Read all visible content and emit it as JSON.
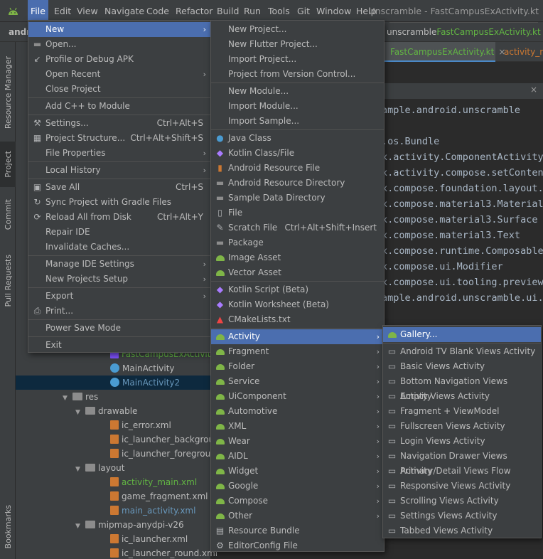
{
  "menubar": {
    "items": [
      "File",
      "Edit",
      "View",
      "Navigate",
      "Code",
      "Refactor",
      "Build",
      "Run",
      "Tools",
      "Git",
      "Window",
      "Help"
    ],
    "active": "File",
    "window_title": "Unscramble - FastCampusExActivity.kt"
  },
  "breadcrumb": {
    "project": "andr",
    "folder": "unscramble",
    "file": "FastCampusExActivity.kt"
  },
  "editor_tabs": [
    {
      "label": "FastCampusExActivity.kt"
    },
    {
      "label": "activity_m"
    }
  ],
  "code_lines": [
    "ample.android.unscramble",
    "",
    ".os.Bundle",
    "x.activity.ComponentActivity",
    "x.activity.compose.setConten",
    "x.compose.foundation.layout.",
    "x.compose.material3.Material",
    "x.compose.material3.Surface",
    "x.compose.material3.Text",
    "x.compose.runtime.Composable",
    "x.compose.ui.Modifier",
    "x.compose.ui.tooling.preview",
    "ample.android.unscramble.ui.t"
  ],
  "side_tabs": [
    "Resource Manager",
    "Project",
    "Commit",
    "Pull Requests",
    "Bookmarks"
  ],
  "tree": [
    {
      "label": "FastCampusExActivity.k",
      "kind": "file-kt"
    },
    {
      "label": "MainActivity",
      "kind": "class"
    },
    {
      "label": "MainActivity2",
      "kind": "class"
    },
    {
      "label": "res",
      "kind": "folder"
    },
    {
      "label": "drawable",
      "kind": "folder"
    },
    {
      "label": "ic_error.xml",
      "kind": "file"
    },
    {
      "label": "ic_launcher_backgroun",
      "kind": "file"
    },
    {
      "label": "ic_launcher_foregroun",
      "kind": "file"
    },
    {
      "label": "layout",
      "kind": "folder"
    },
    {
      "label": "activity_main.xml",
      "kind": "file"
    },
    {
      "label": "game_fragment.xml",
      "kind": "file"
    },
    {
      "label": "main_activity.xml",
      "kind": "file"
    },
    {
      "label": "mipmap-anydpi-v26",
      "kind": "folder"
    },
    {
      "label": "ic_launcher.xml",
      "kind": "file"
    },
    {
      "label": "ic_launcher_round.xml",
      "kind": "file"
    }
  ],
  "file_menu": [
    {
      "label": "New",
      "submenu": true,
      "highlight": true
    },
    {
      "label": "Open...",
      "icon": "folder-icon"
    },
    {
      "label": "Profile or Debug APK",
      "icon": "profile-icon"
    },
    {
      "label": "Open Recent",
      "submenu": true
    },
    {
      "label": "Close Project"
    },
    {
      "sep": true
    },
    {
      "label": "Add C++ to Module"
    },
    {
      "sep": true
    },
    {
      "label": "Settings...",
      "shortcut": "Ctrl+Alt+S",
      "icon": "wrench-icon"
    },
    {
      "label": "Project Structure...",
      "shortcut": "Ctrl+Alt+Shift+S",
      "icon": "project-structure-icon"
    },
    {
      "label": "File Properties",
      "submenu": true
    },
    {
      "sep": true
    },
    {
      "label": "Local History",
      "submenu": true
    },
    {
      "sep": true
    },
    {
      "label": "Save All",
      "shortcut": "Ctrl+S",
      "icon": "save-icon"
    },
    {
      "label": "Sync Project with Gradle Files",
      "icon": "gradle-sync-icon"
    },
    {
      "label": "Reload All from Disk",
      "shortcut": "Ctrl+Alt+Y",
      "icon": "reload-icon"
    },
    {
      "label": "Repair IDE"
    },
    {
      "label": "Invalidate Caches..."
    },
    {
      "sep": true
    },
    {
      "label": "Manage IDE Settings",
      "submenu": true
    },
    {
      "label": "New Projects Setup",
      "submenu": true
    },
    {
      "sep": true
    },
    {
      "label": "Export",
      "submenu": true
    },
    {
      "label": "Print...",
      "icon": "print-icon"
    },
    {
      "sep": true
    },
    {
      "label": "Power Save Mode"
    },
    {
      "sep": true
    },
    {
      "label": "Exit"
    }
  ],
  "new_menu": [
    {
      "label": "New Project..."
    },
    {
      "label": "New Flutter Project..."
    },
    {
      "label": "Import Project..."
    },
    {
      "label": "Project from Version Control..."
    },
    {
      "sep": true
    },
    {
      "label": "New Module..."
    },
    {
      "label": "Import Module..."
    },
    {
      "label": "Import Sample..."
    },
    {
      "sep": true
    },
    {
      "label": "Java Class",
      "icon": "java-class-icon"
    },
    {
      "label": "Kotlin Class/File",
      "icon": "kotlin-icon"
    },
    {
      "label": "Android Resource File",
      "icon": "resource-file-icon"
    },
    {
      "label": "Android Resource Directory",
      "icon": "folder-icon"
    },
    {
      "label": "Sample Data Directory",
      "icon": "folder-icon"
    },
    {
      "label": "File",
      "icon": "file-icon"
    },
    {
      "label": "Scratch File",
      "shortcut": "Ctrl+Alt+Shift+Insert",
      "icon": "scratch-icon"
    },
    {
      "label": "Package",
      "icon": "package-icon"
    },
    {
      "label": "Image Asset",
      "icon": "android-icon"
    },
    {
      "label": "Vector Asset",
      "icon": "android-icon"
    },
    {
      "sep": true
    },
    {
      "label": "Kotlin Script (Beta)",
      "icon": "kotlin-script-icon"
    },
    {
      "label": "Kotlin Worksheet (Beta)",
      "icon": "kotlin-worksheet-icon"
    },
    {
      "label": "CMakeLists.txt",
      "icon": "cmake-icon"
    },
    {
      "sep": true
    },
    {
      "label": "Activity",
      "submenu": true,
      "highlight": true,
      "icon": "android-icon"
    },
    {
      "label": "Fragment",
      "submenu": true,
      "icon": "android-icon"
    },
    {
      "label": "Folder",
      "submenu": true,
      "icon": "android-icon"
    },
    {
      "label": "Service",
      "submenu": true,
      "icon": "android-icon"
    },
    {
      "label": "UiComponent",
      "submenu": true,
      "icon": "android-icon"
    },
    {
      "label": "Automotive",
      "submenu": true,
      "icon": "android-icon"
    },
    {
      "label": "XML",
      "submenu": true,
      "icon": "android-icon"
    },
    {
      "label": "Wear",
      "submenu": true,
      "icon": "android-icon"
    },
    {
      "label": "AIDL",
      "submenu": true,
      "icon": "android-icon"
    },
    {
      "label": "Widget",
      "submenu": true,
      "icon": "android-icon"
    },
    {
      "label": "Google",
      "submenu": true,
      "icon": "android-icon"
    },
    {
      "label": "Compose",
      "submenu": true,
      "icon": "android-icon"
    },
    {
      "label": "Other",
      "submenu": true,
      "icon": "android-icon"
    },
    {
      "label": "Resource Bundle",
      "icon": "resource-bundle-icon"
    },
    {
      "label": "EditorConfig File",
      "icon": "gear-icon"
    }
  ],
  "activity_menu": [
    {
      "label": "Gallery...",
      "highlight": true,
      "icon": "android-icon"
    },
    {
      "sep": true
    },
    {
      "label": "Android TV Blank Views Activity",
      "icon": "template-icon"
    },
    {
      "label": "Basic Views Activity",
      "icon": "template-icon"
    },
    {
      "label": "Bottom Navigation Views Activity",
      "icon": "template-icon"
    },
    {
      "label": "Empty Views Activity",
      "icon": "template-icon"
    },
    {
      "label": "Fragment + ViewModel",
      "icon": "template-icon"
    },
    {
      "label": "Fullscreen Views Activity",
      "icon": "template-icon"
    },
    {
      "label": "Login Views Activity",
      "icon": "template-icon"
    },
    {
      "label": "Navigation Drawer Views Activity",
      "icon": "template-icon"
    },
    {
      "label": "Primary/Detail Views Flow",
      "icon": "template-icon"
    },
    {
      "label": "Responsive Views Activity",
      "icon": "template-icon"
    },
    {
      "label": "Scrolling Views Activity",
      "icon": "template-icon"
    },
    {
      "label": "Settings Views Activity",
      "icon": "template-icon"
    },
    {
      "label": "Tabbed Views Activity",
      "icon": "template-icon"
    }
  ],
  "colors": {
    "accent": "#4b6eaf",
    "menu_bg": "#3c3f41",
    "editor_bg": "#2b2b2b",
    "kotlin_green": "#62b543"
  }
}
